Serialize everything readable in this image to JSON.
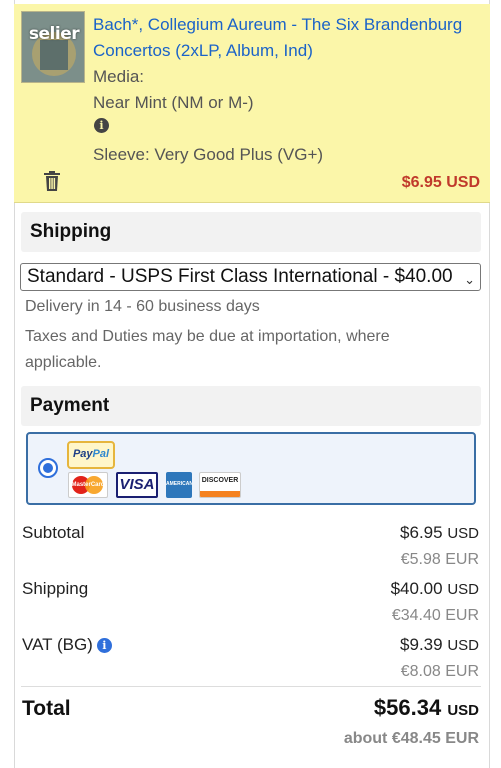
{
  "cart_item": {
    "thumbnail_watermark": "selier",
    "title": "Bach*, Collegium Aureum - The Six Brandenburg Concertos (2xLP, Album, Ind)",
    "media_label": "Media:",
    "media_condition": "Near Mint (NM or M-)",
    "info_icon": "i",
    "sleeve": "Sleeve: Very Good Plus (VG+)",
    "price": "$6.95 USD"
  },
  "shipping": {
    "heading": "Shipping",
    "selected_option": "Standard - USPS First Class International - $40.00",
    "chevron": "⌄",
    "delivery": "Delivery in 14 - 60 business days",
    "taxes_note": "Taxes and Duties may be due at importation, where applicable."
  },
  "payment": {
    "heading": "Payment",
    "paypal_logo_1": "Pay",
    "paypal_logo_2": "Pal",
    "visa_logo": "VISA",
    "mastercard_logo": "MasterCard",
    "amex_logo": "AMERICAN EXPRESS",
    "discover_logo": "DISCOVER"
  },
  "summary": {
    "subtotal_label": "Subtotal",
    "subtotal_usd": "$6.95",
    "subtotal_eur": "€5.98 EUR",
    "shipping_label": "Shipping",
    "shipping_usd": "$40.00",
    "shipping_eur": "€34.40 EUR",
    "vat_label": "VAT (BG)",
    "vat_usd": "$9.39",
    "vat_eur": "€8.08 EUR",
    "currency": "USD",
    "total_label": "Total",
    "total_usd": "$56.34",
    "about_label": "about",
    "total_eur": "€48.45 EUR"
  },
  "colors": {
    "item_highlight": "#fbf6a9",
    "link_blue": "#1b63c8",
    "price_red": "#c0392b",
    "payment_border": "#3a6ea5"
  },
  "icons": [
    "trash-icon",
    "info-icon",
    "chevron-down-icon",
    "radio-selected-icon"
  ]
}
